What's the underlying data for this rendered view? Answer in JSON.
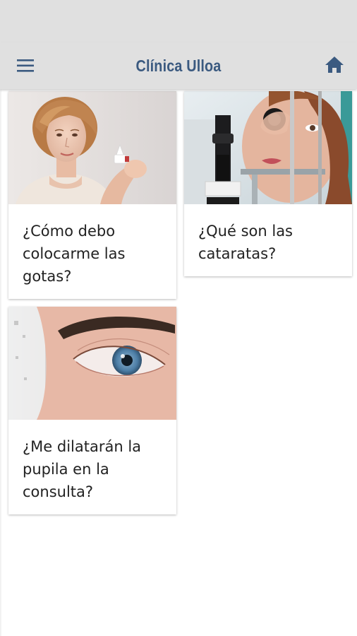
{
  "app_bar": {
    "title": "Clínica Ulloa",
    "menu_icon": "hamburger-menu-icon",
    "home_icon": "home-icon",
    "title_color": "#3b5a80",
    "icon_color": "#3b5a80"
  },
  "cards": [
    {
      "title": "¿Cómo debo colocarme las gotas?",
      "image": "woman-holding-eye-drops-photo"
    },
    {
      "title": "¿Qué son las cataratas?",
      "image": "eye-examination-slit-lamp-photo"
    },
    {
      "title": "¿Me dilatarán la pupila en la consulta?",
      "image": "blue-eye-closeup-photo"
    }
  ]
}
